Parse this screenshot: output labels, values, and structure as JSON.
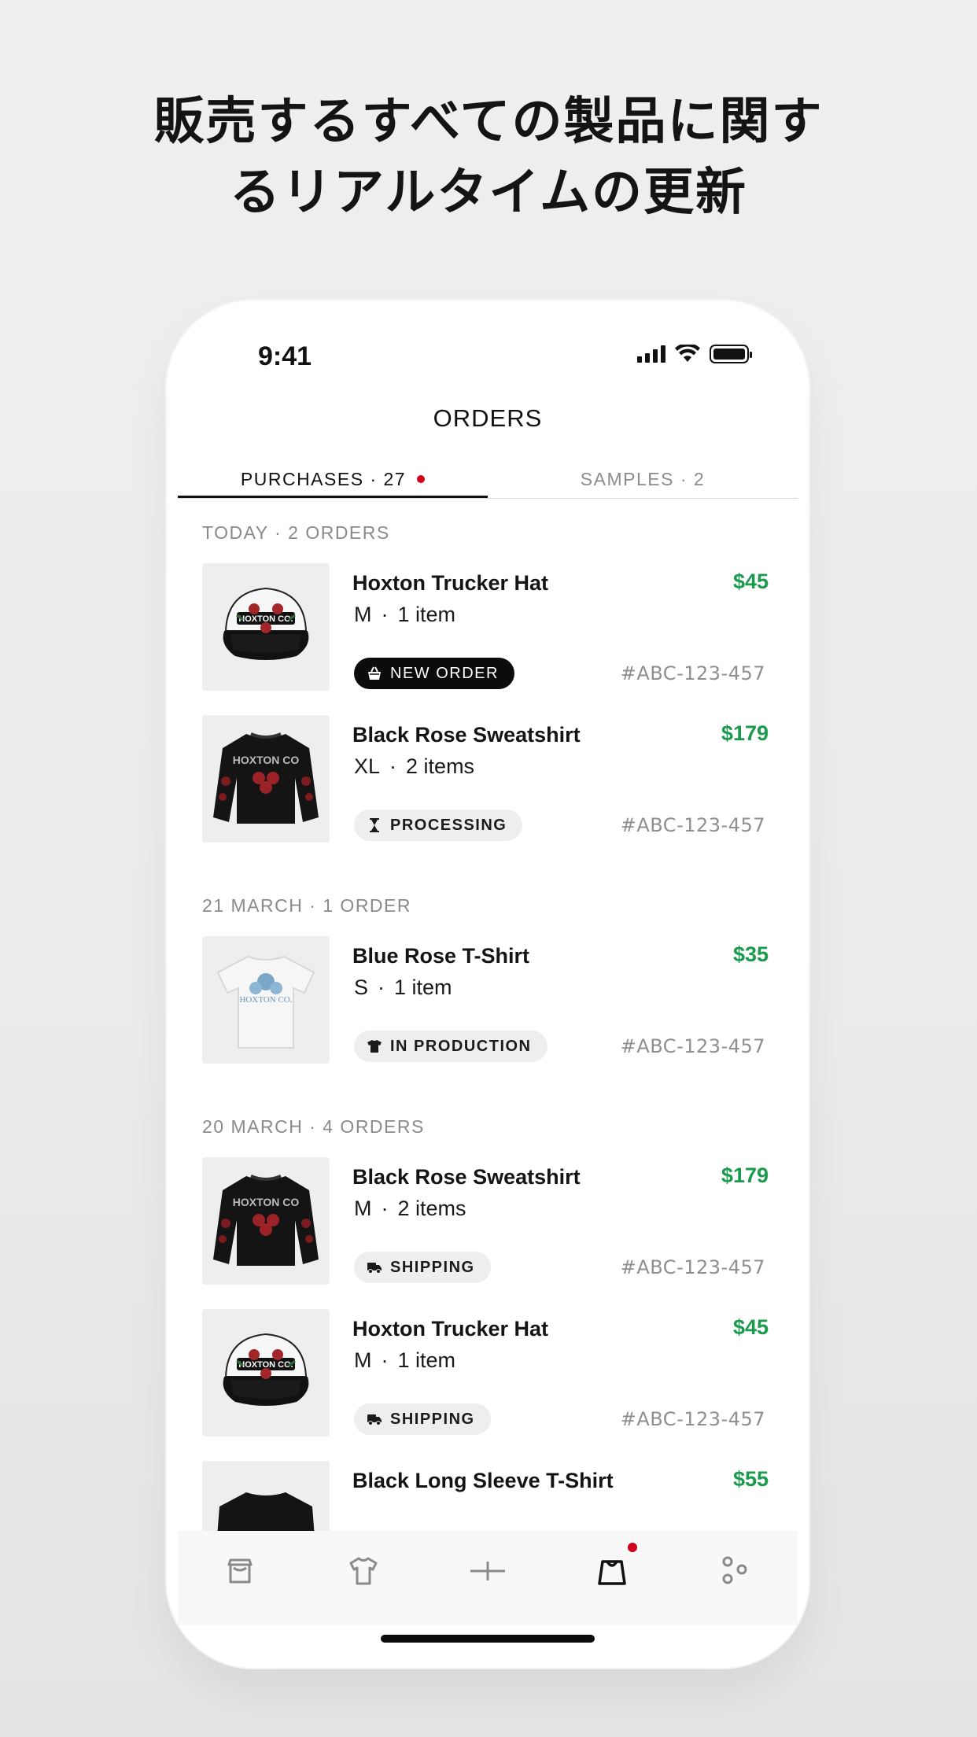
{
  "headline": {
    "line1": "販売するすべての製品に関す",
    "line2": "るリアルタイムの更新"
  },
  "status_bar": {
    "time": "9:41"
  },
  "screen_title": "ORDERS",
  "tabs": [
    {
      "label": "PURCHASES · 27",
      "active": true,
      "has_dot": true
    },
    {
      "label": "SAMPLES · 2",
      "active": false
    }
  ],
  "groups": [
    {
      "header": "TODAY · 2 ORDERS",
      "orders": [
        {
          "name": "Hoxton Trucker Hat",
          "size": "M",
          "items": "1 item",
          "price": "$45",
          "status": "NEW ORDER",
          "status_icon": "basket-icon",
          "order_id": "#ABC-123-457",
          "product": "hat"
        },
        {
          "name": "Black Rose Sweatshirt",
          "size": "XL",
          "items": "2 items",
          "price": "$179",
          "status": "PROCESSING",
          "status_icon": "hourglass-icon",
          "order_id": "#ABC-123-457",
          "product": "sweatshirt"
        }
      ]
    },
    {
      "header": "21 MARCH · 1 ORDER",
      "orders": [
        {
          "name": "Blue Rose T-Shirt",
          "size": "S",
          "items": "1 item",
          "price": "$35",
          "status": "IN PRODUCTION",
          "status_icon": "tshirt-icon",
          "order_id": "#ABC-123-457",
          "product": "tshirt"
        }
      ]
    },
    {
      "header": "20 MARCH · 4 ORDERS",
      "orders": [
        {
          "name": "Black Rose Sweatshirt",
          "size": "M",
          "items": "2 items",
          "price": "$179",
          "status": "SHIPPING",
          "status_icon": "truck-icon",
          "order_id": "#ABC-123-457",
          "product": "sweatshirt"
        },
        {
          "name": "Hoxton Trucker Hat",
          "size": "M",
          "items": "1 item",
          "price": "$45",
          "status": "SHIPPING",
          "status_icon": "truck-icon",
          "order_id": "#ABC-123-457",
          "product": "hat"
        },
        {
          "name": "Black Long Sleeve T-Shirt",
          "price": "$55",
          "product": "longsleeve"
        }
      ]
    }
  ],
  "bottom_tabs": [
    {
      "icon": "store-icon"
    },
    {
      "icon": "tshirt-icon"
    },
    {
      "icon": "plus-icon"
    },
    {
      "icon": "shopping-bag-icon",
      "active": true,
      "has_dot": true
    },
    {
      "icon": "more-dots-icon"
    }
  ],
  "colors": {
    "price": "#1a9a4c",
    "notification_dot": "#d0021b"
  }
}
